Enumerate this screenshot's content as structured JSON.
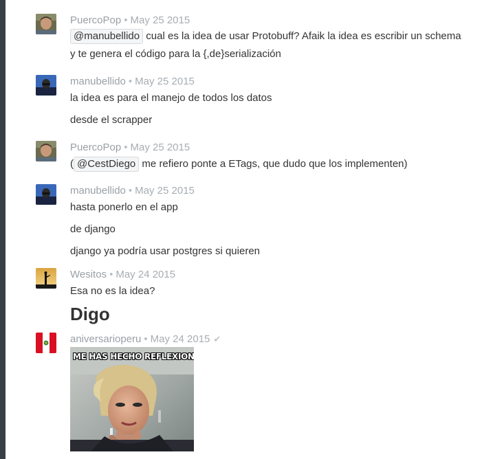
{
  "messages": [
    {
      "user": "PuercoPop",
      "date": "May 25 2015",
      "lines": [
        {
          "mention": "@manubellido",
          "text": " cual es la idea de usar Protobuff? Afaik la idea es escribir un schema"
        },
        {
          "text": "y te genera el código para la {,de}serialización"
        }
      ]
    },
    {
      "user": "manubellido",
      "date": "May 25 2015",
      "lines": [
        {
          "text": "la idea es para el manejo de todos los datos"
        },
        {
          "text": "desde el scrapper"
        }
      ]
    },
    {
      "user": "PuercoPop",
      "date": "May 25 2015",
      "lines": [
        {
          "prefix": "(",
          "mention": "@CestDiego",
          "text": " me refiero ponte a ETags, que dudo que los implementen)"
        }
      ]
    },
    {
      "user": "manubellido",
      "date": "May 25 2015",
      "lines": [
        {
          "text": "hasta ponerlo en el app"
        },
        {
          "text": "de django"
        },
        {
          "text": "django ya podría usar postgres si quieren"
        }
      ]
    },
    {
      "user": "Wesitos",
      "date": "May 24 2015",
      "lines": [
        {
          "text": "Esa no es la idea?"
        }
      ],
      "heading": "Digo"
    },
    {
      "user": "aniversarioperu",
      "date": "May 24 2015",
      "status_icon": "checkmark-icon",
      "image_caption": "ME HAS HECHO REFLEXIONAR"
    }
  ],
  "separator": "•",
  "check_glyph": "✔"
}
